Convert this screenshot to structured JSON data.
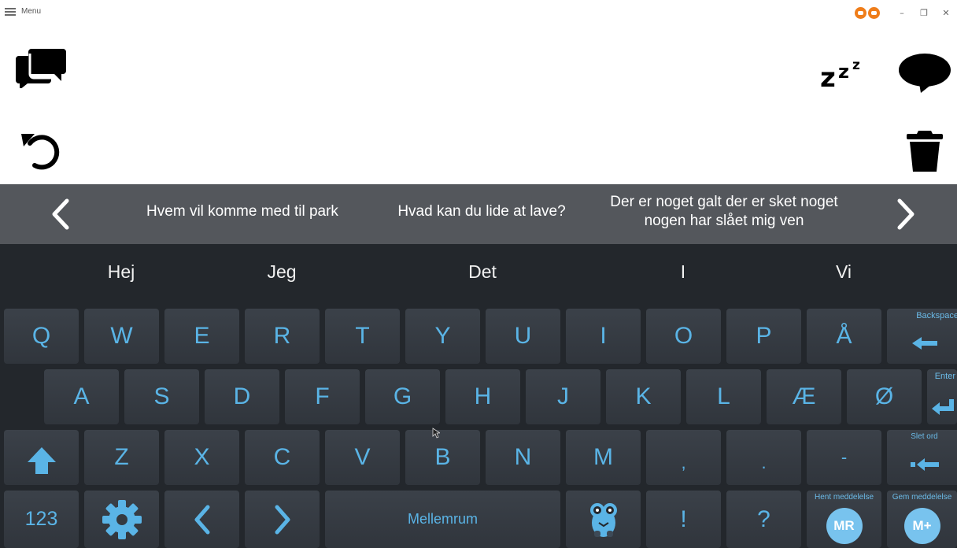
{
  "titlebar": {
    "menu_label": "Menu",
    "window_controls": {
      "minimize": "–",
      "restore": "❐",
      "close": "✕"
    }
  },
  "top_actions": {
    "left": [
      "messages-icon",
      "undo-icon"
    ],
    "right": [
      "sleep-icon",
      "speak-icon",
      "trash-icon"
    ]
  },
  "phrases": {
    "items": [
      "Hvem vil komme med til park",
      "Hvad kan du lide at lave?",
      "Der er noget galt der er sket noget nogen har slået mig ven"
    ]
  },
  "predictions": [
    "Hej",
    "Jeg",
    "Det",
    "I",
    "Vi"
  ],
  "keyboard": {
    "row1": [
      "Q",
      "W",
      "E",
      "R",
      "T",
      "Y",
      "U",
      "I",
      "O",
      "P",
      "Å"
    ],
    "row2": [
      "A",
      "S",
      "D",
      "F",
      "G",
      "H",
      "J",
      "K",
      "L",
      "Æ",
      "Ø"
    ],
    "row3": [
      "Z",
      "X",
      "C",
      "V",
      "B",
      "N",
      "M",
      ",",
      ".",
      "-"
    ],
    "backspace": "Backspace",
    "enter": "Enter",
    "delete_word": "Slet ord",
    "numbers": "123",
    "space": "Mellemrum",
    "exclaim": "!",
    "question": "?",
    "fetch_message": "Hent meddelelse",
    "fetch_badge": "MR",
    "save_message": "Gem meddelelse",
    "save_badge": "M+"
  },
  "colors": {
    "accent": "#5ab4e6",
    "keyboard_bg": "#23272c",
    "phrase_bar_bg": "#54575c",
    "badge_orange": "#ef7d1a"
  }
}
